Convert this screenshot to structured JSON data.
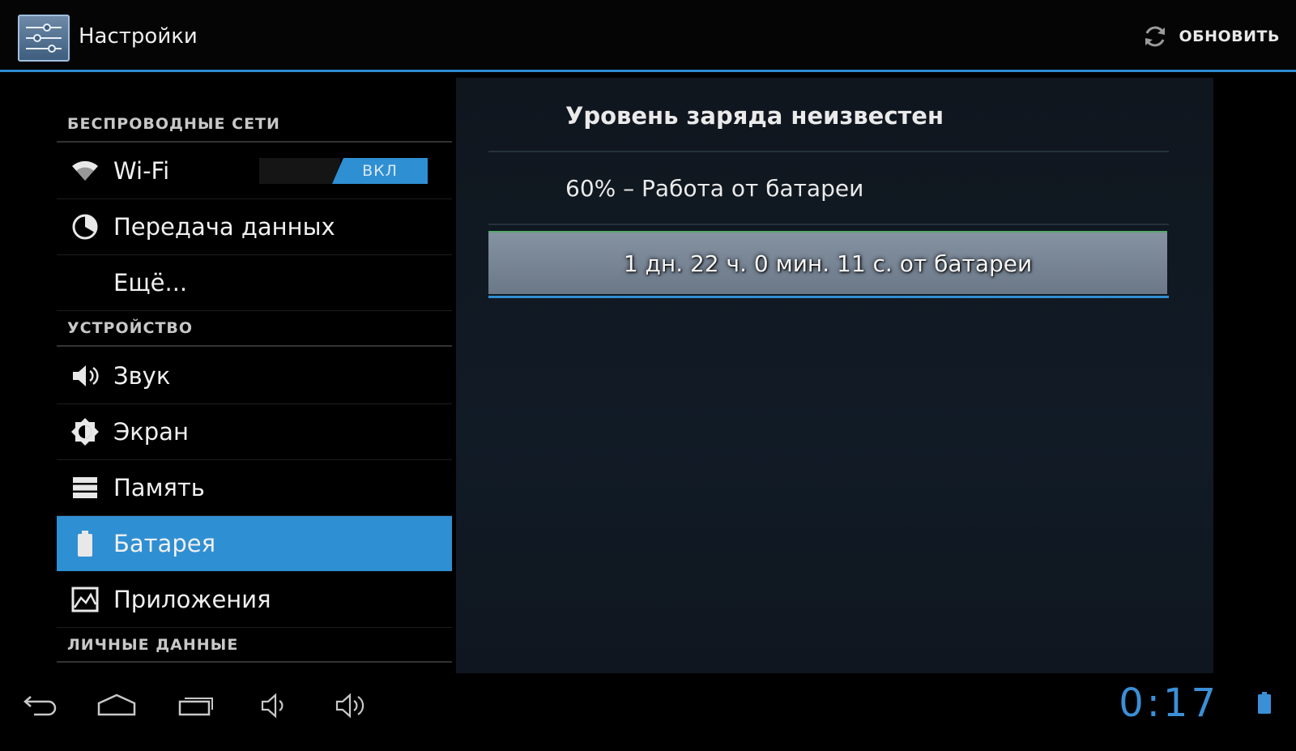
{
  "actionbar": {
    "title": "Настройки",
    "refresh_label": "ОБНОВИТЬ"
  },
  "sidebar": {
    "sections": [
      {
        "header": "БЕСПРОВОДНЫЕ СЕТИ"
      },
      {
        "header": "УСТРОЙСТВО"
      },
      {
        "header": "ЛИЧНЫЕ ДАННЫЕ"
      }
    ],
    "items": [
      {
        "label": "Wi-Fi",
        "icon": "wifi-icon"
      },
      {
        "label": "Передача данных",
        "icon": "data-usage-icon"
      },
      {
        "label": "Ещё..."
      },
      {
        "label": "Звук",
        "icon": "speaker-icon"
      },
      {
        "label": "Экран",
        "icon": "brightness-icon"
      },
      {
        "label": "Память",
        "icon": "storage-icon"
      },
      {
        "label": "Батарея",
        "icon": "battery-icon",
        "selected": true
      },
      {
        "label": "Приложения",
        "icon": "apps-icon"
      }
    ],
    "wifi_toggle": "ВКЛ"
  },
  "battery_panel": {
    "status": "Уровень заряда неизвестен",
    "level": "60% – Работа от батареи",
    "duration": "1 дн. 22 ч. 0 мин. 11 с. от батареи"
  },
  "navbar": {
    "clock": "0:17"
  },
  "colors": {
    "accent": "#2f8fd3",
    "background": "#000000",
    "panel": "#111b26"
  }
}
